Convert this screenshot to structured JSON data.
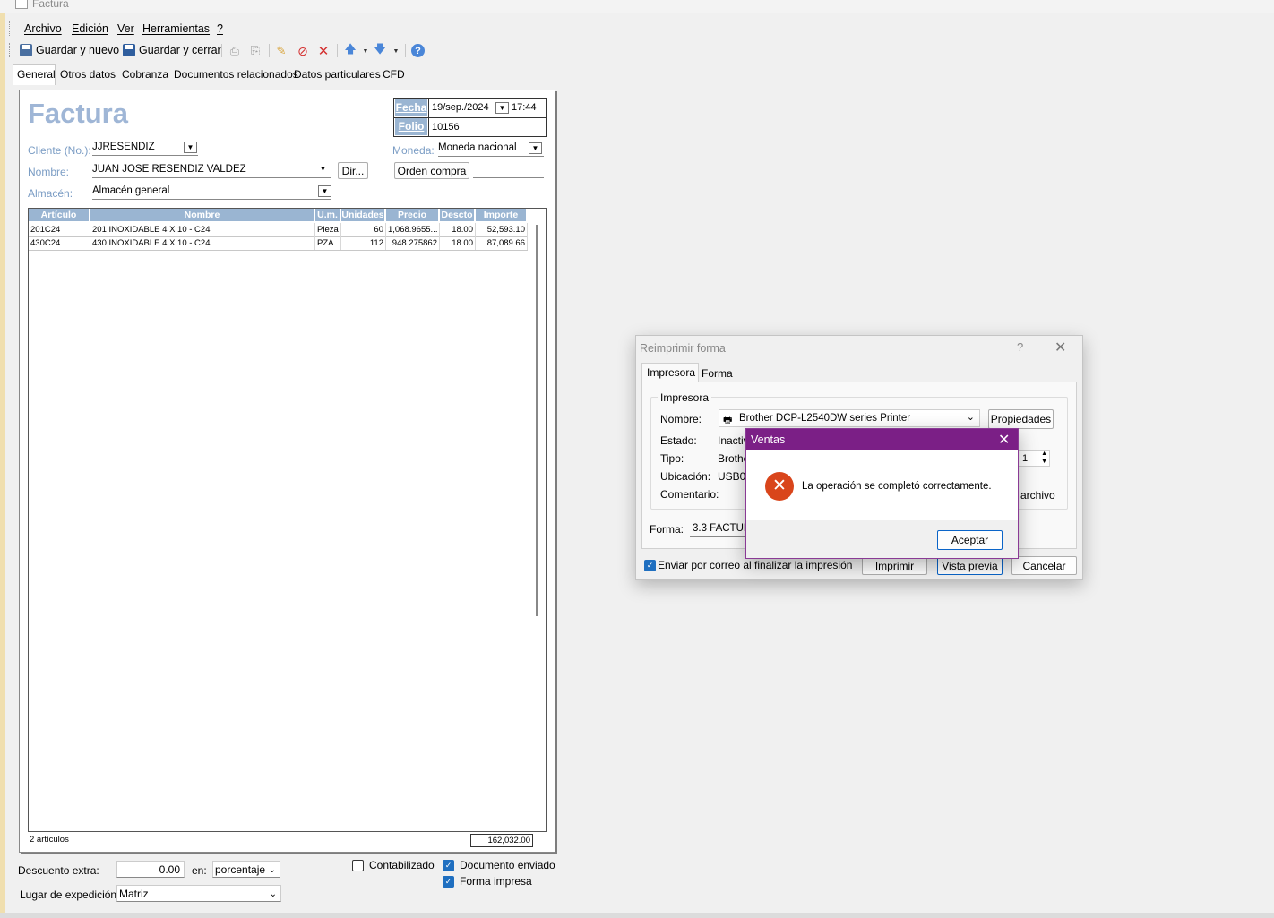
{
  "window": {
    "title": "Factura"
  },
  "menu": [
    "Archivo",
    "Edición",
    "Ver",
    "Herramientas",
    "?"
  ],
  "toolbar": {
    "save_new": "Guardar y nuevo",
    "save_close": "Guardar y cerrar"
  },
  "tabs": [
    "General",
    "Otros datos",
    "Cobranza",
    "Documentos relacionados",
    "Datos particulares",
    "CFD"
  ],
  "form": {
    "heading": "Factura",
    "fecha_label": "Fecha",
    "fecha": "19/sep./2024",
    "hora": "17:44",
    "folio_label": "Folio",
    "folio": "10156",
    "cliente_label": "Cliente (No.):",
    "cliente": "JJRESENDIZ",
    "nombre_label": "Nombre:",
    "nombre": "JUAN JOSE RESENDIZ VALDEZ",
    "dir_button": "Dir...",
    "almacen_label": "Almacén:",
    "almacen": "Almacén general",
    "moneda_label": "Moneda:",
    "moneda": "Moneda nacional",
    "orden_button": "Orden compra"
  },
  "grid": {
    "headers": [
      "Artículo",
      "Nombre",
      "U.m.",
      "Unidades",
      "Precio",
      "Descto",
      "Importe"
    ],
    "rows": [
      [
        "201C24",
        "201 INOXIDABLE 4 X 10 - C24",
        "Pieza",
        "60",
        "1,068.9655...",
        "18.00",
        "52,593.10"
      ],
      [
        "430C24",
        "430 INOXIDABLE 4 X 10 - C24",
        "PZA",
        "112",
        "948.275862",
        "18.00",
        "87,089.66"
      ]
    ],
    "count_label": "2 artículos",
    "total": "162,032.00"
  },
  "bottom": {
    "descuento_label": "Descuento extra:",
    "descuento": "0.00",
    "en_label": "en:",
    "en_value": "porcentaje",
    "lugar_label": "Lugar de expedición:",
    "lugar": "Matriz",
    "contabilizado": "Contabilizado",
    "doc_enviado": "Documento enviado",
    "forma_impresa": "Forma impresa"
  },
  "reprint": {
    "title": "Reimprimir forma",
    "tabs": [
      "Impresora",
      "Forma"
    ],
    "group": "Impresora",
    "nombre_label": "Nombre:",
    "printer": "Brother DCP-L2540DW series Printer",
    "propiedades": "Propiedades",
    "estado_label": "Estado:",
    "estado": "Inactiv",
    "tipo_label": "Tipo:",
    "tipo": "Brothe",
    "ubicacion_label": "Ubicación:",
    "ubicacion": "USB00",
    "comentario_label": "Comentario:",
    "copies": "1",
    "archivo": "archivo",
    "forma_label": "Forma:",
    "forma": "3.3 FACTUR",
    "email_check": "Enviar por correo al finalizar la impresión",
    "imprimir": "Imprimir",
    "vista_previa": "Vista previa",
    "cancelar": "Cancelar"
  },
  "message": {
    "title": "Ventas",
    "text": "La operación se completó correctamente.",
    "ok": "Aceptar"
  }
}
